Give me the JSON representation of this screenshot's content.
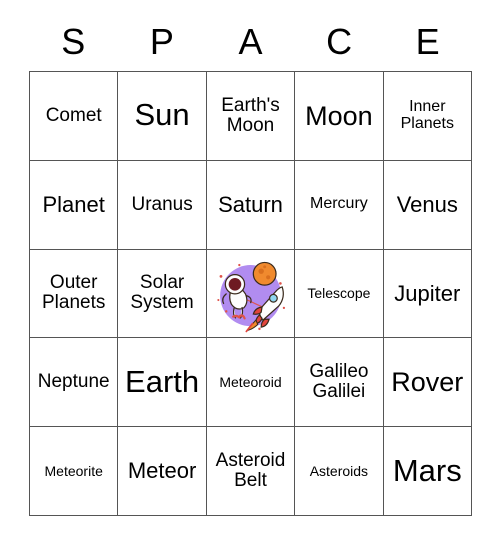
{
  "card": {
    "title_letters": [
      "S",
      "P",
      "A",
      "C",
      "E"
    ],
    "free_space_alt": "astronaut-planet-rocket-illustration",
    "colors": {
      "grid_line": "#555555",
      "text": "#000000",
      "background": "#ffffff",
      "free_space_circle": "#b18cf0",
      "planet_orange": "#f08a2e",
      "rocket_red": "#e2453c",
      "visor_dark_red": "#6e1a22",
      "suit_white": "#fdfdfd"
    },
    "rows": [
      [
        {
          "label": "Comet",
          "size": "m"
        },
        {
          "label": "Sun",
          "size": "xxl"
        },
        {
          "label": "Earth's Moon",
          "size": "m"
        },
        {
          "label": "Moon",
          "size": "xl"
        },
        {
          "label": "Inner Planets",
          "size": "s"
        }
      ],
      [
        {
          "label": "Planet",
          "size": "l"
        },
        {
          "label": "Uranus",
          "size": "m"
        },
        {
          "label": "Saturn",
          "size": "l"
        },
        {
          "label": "Mercury",
          "size": "s"
        },
        {
          "label": "Venus",
          "size": "l"
        }
      ],
      [
        {
          "label": "Outer Planets",
          "size": "m"
        },
        {
          "label": "Solar System",
          "size": "m"
        },
        {
          "label": "",
          "size": "free"
        },
        {
          "label": "Telescope",
          "size": "xs"
        },
        {
          "label": "Jupiter",
          "size": "l"
        }
      ],
      [
        {
          "label": "Neptune",
          "size": "m"
        },
        {
          "label": "Earth",
          "size": "xxl"
        },
        {
          "label": "Meteoroid",
          "size": "xs"
        },
        {
          "label": "Galileo Galilei",
          "size": "m"
        },
        {
          "label": "Rover",
          "size": "xl"
        }
      ],
      [
        {
          "label": "Meteorite",
          "size": "xs"
        },
        {
          "label": "Meteor",
          "size": "l"
        },
        {
          "label": "Asteroid Belt",
          "size": "m"
        },
        {
          "label": "Asteroids",
          "size": "xs"
        },
        {
          "label": "Mars",
          "size": "xxl"
        }
      ]
    ]
  }
}
